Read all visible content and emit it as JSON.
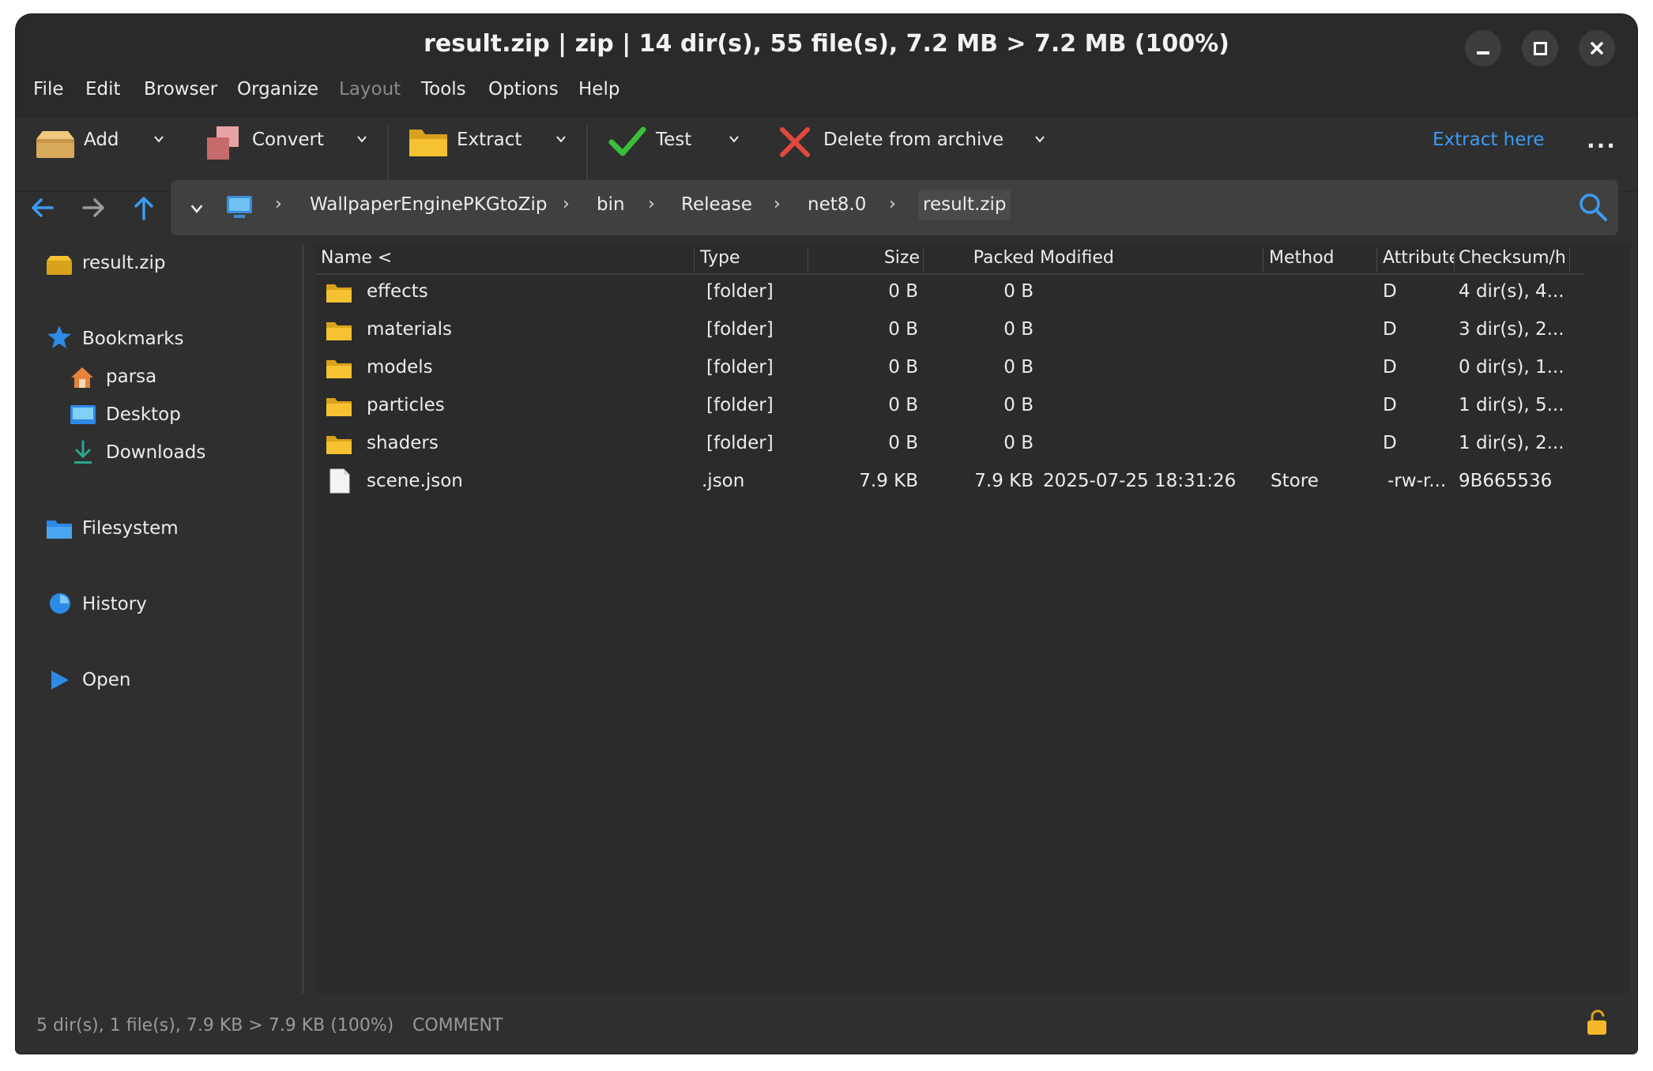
{
  "window": {
    "title": "result.zip | zip | 14 dir(s), 55 file(s), 7.2 MB > 7.2 MB (100%)",
    "controls": [
      "minimize-icon",
      "maximize-icon",
      "close-icon"
    ]
  },
  "menu": {
    "items": [
      "File",
      "Edit",
      "Browser",
      "Organize",
      "Layout",
      "Tools",
      "Options",
      "Help"
    ],
    "disabled": [
      "Layout"
    ]
  },
  "toolbar": {
    "add": "Add",
    "convert": "Convert",
    "extract": "Extract",
    "test": "Test",
    "delete": "Delete from archive",
    "extract_here": "Extract here",
    "more": "···"
  },
  "address": {
    "crumbs": [
      "WallpaperEnginePKGtoZip",
      "bin",
      "Release",
      "net8.0",
      "result.zip"
    ],
    "sep": "›"
  },
  "sidebar": {
    "archive": "result.zip",
    "bookmarks": "Bookmarks",
    "bookmark_items": [
      "parsa",
      "Desktop",
      "Downloads"
    ],
    "filesystem": "Filesystem",
    "history": "History",
    "open": "Open"
  },
  "table": {
    "columns": [
      "Name <",
      "Type",
      "Size",
      "Packed",
      "Modified",
      "Method",
      "Attributes",
      "Checksum/h"
    ],
    "rows": [
      {
        "name": "effects",
        "type": "[folder]",
        "size": "0 B",
        "packed": "0 B",
        "modified": "",
        "method": "",
        "attr": "D",
        "checksum": "4 dir(s), 4..."
      },
      {
        "name": "materials",
        "type": "[folder]",
        "size": "0 B",
        "packed": "0 B",
        "modified": "",
        "method": "",
        "attr": "D",
        "checksum": "3 dir(s), 2..."
      },
      {
        "name": "models",
        "type": "[folder]",
        "size": "0 B",
        "packed": "0 B",
        "modified": "",
        "method": "",
        "attr": "D",
        "checksum": "0 dir(s), 1..."
      },
      {
        "name": "particles",
        "type": "[folder]",
        "size": "0 B",
        "packed": "0 B",
        "modified": "",
        "method": "",
        "attr": "D",
        "checksum": "1 dir(s), 5..."
      },
      {
        "name": "shaders",
        "type": "[folder]",
        "size": "0 B",
        "packed": "0 B",
        "modified": "",
        "method": "",
        "attr": "D",
        "checksum": "1 dir(s), 2..."
      },
      {
        "name": "scene.json",
        "type": ".json",
        "size": "7.9 KB",
        "packed": "7.9 KB",
        "modified": "2025-07-25 18:31:26",
        "method": "Store",
        "attr": "-rw-r...",
        "checksum": "9B665536"
      }
    ]
  },
  "status": {
    "summary": "5 dir(s), 1 file(s), 7.9 KB > 7.9 KB (100%)",
    "comment": "COMMENT"
  },
  "colors": {
    "accent": "#3b9cf2",
    "folder": "#f5c232",
    "background": "#2f2f2f",
    "list_background": "#2b2b2b"
  }
}
